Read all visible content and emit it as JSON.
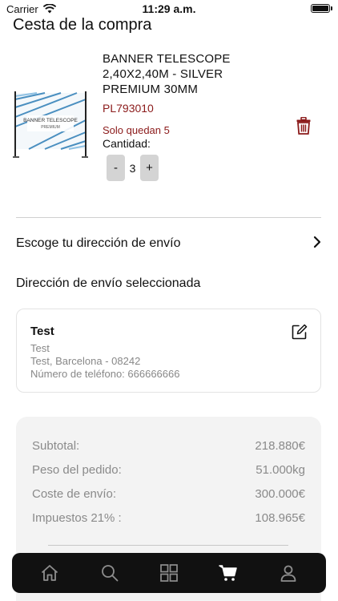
{
  "status_bar": {
    "carrier": "Carrier",
    "time": "11:29 a.m."
  },
  "page": {
    "title": "Cesta de la compra"
  },
  "product": {
    "name": "BANNER TELESCOPE 2,40X2,40M - SILVER PREMIUM 30MM",
    "sku": "PL793010",
    "stock_note": "Solo quedan 5",
    "quantity_label": "Cantidad:",
    "quantity": "3",
    "minus": "-",
    "plus": "+",
    "image_text_line1": "BANNER TELESCOPE",
    "image_text_line2": "PREMIUM"
  },
  "shipping": {
    "choose_label": "Escoge tu dirección de envío",
    "selected_heading": "Dirección de envío seleccionada",
    "address": {
      "name": "Test",
      "line1": "Test",
      "line2": "Test, Barcelona - 08242",
      "phone": "Número de teléfono: 666666666"
    }
  },
  "summary": {
    "subtotal_label": "Subtotal:",
    "subtotal_value": "218.880€",
    "weight_label": "Peso del pedido:",
    "weight_value": "51.000kg",
    "shipping_label": "Coste de envío:",
    "shipping_value": "300.000€",
    "tax_label": "Impuestos 21% :",
    "tax_value": "108.965€"
  },
  "tabs": [
    {
      "icon": "home-icon"
    },
    {
      "icon": "search-icon"
    },
    {
      "icon": "grid-icon"
    },
    {
      "icon": "cart-icon",
      "active": true
    },
    {
      "icon": "user-icon"
    }
  ],
  "colors": {
    "accent_red": "#8b1a1a",
    "tab_bar_bg": "#111111",
    "stepper_bg": "#d4d4d4",
    "summary_bg": "#f3f3f3"
  }
}
